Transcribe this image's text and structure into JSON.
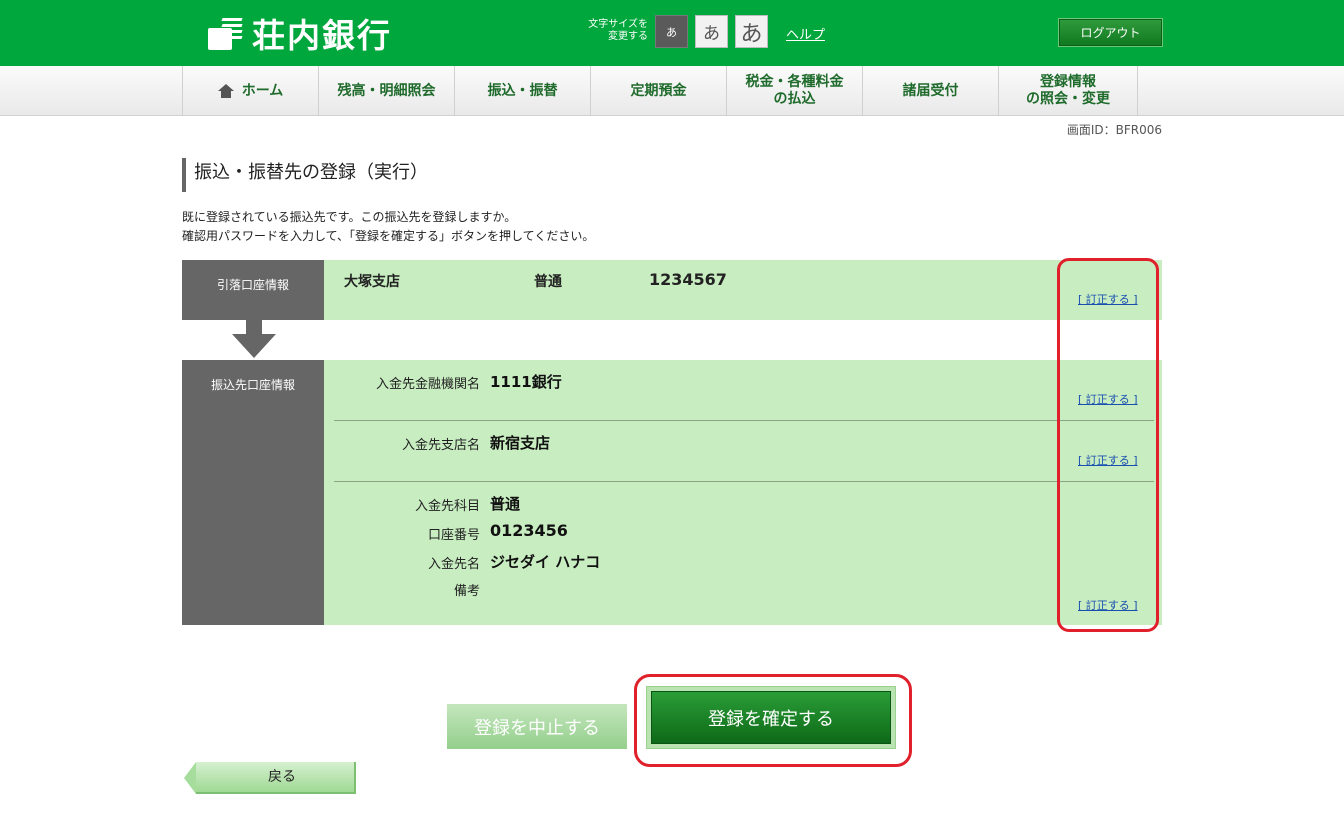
{
  "header": {
    "bank_name": "荘内銀行",
    "font_size_label_1": "文字サイズを",
    "font_size_label_2": "変更する",
    "font_size_small": "あ",
    "font_size_medium": "あ",
    "font_size_large": "あ",
    "help": "ヘルプ",
    "logout": "ログアウト"
  },
  "nav": {
    "items": [
      {
        "label": "ホーム",
        "icon": "home-icon"
      },
      {
        "label": "残高・明細照会"
      },
      {
        "label": "振込・振替"
      },
      {
        "label": "定期預金"
      },
      {
        "label_line1": "税金・各種料金",
        "label_line2": "の払込"
      },
      {
        "label": "諸届受付"
      },
      {
        "label_line1": "登録情報",
        "label_line2": "の照会・変更"
      }
    ]
  },
  "screen_id": "画面ID：BFR006",
  "page_title": "振込・振替先の登録（実行）",
  "description": {
    "line1": "既に登録されている振込先です。この振込先を登録しますか。",
    "line2": "確認用パスワードを入力して、「登録を確定する」ボタンを押してください。"
  },
  "debit_account": {
    "label": "引落口座情報",
    "branch": "大塚支店",
    "type": "普通",
    "number": "1234567",
    "correct_link": "[ 訂正する ]"
  },
  "payee_account": {
    "label": "振込先口座情報",
    "bank_label": "入金先金融機関名",
    "bank_value": "1111銀行",
    "branch_label": "入金先支店名",
    "branch_value": "新宿支店",
    "subject_label": "入金先科目",
    "subject_value": "普通",
    "number_label": "口座番号",
    "number_value": "0123456",
    "name_label": "入金先名",
    "name_value": "ジセダイ ハナコ",
    "remarks_label": "備考",
    "remarks_value": "",
    "correct_link_bank": "[ 訂正する ]",
    "correct_link_branch": "[ 訂正する ]",
    "correct_link_account": "[ 訂正する ]"
  },
  "actions": {
    "cancel": "登録を中止する",
    "confirm": "登録を確定する",
    "back": "戻る"
  },
  "colors": {
    "brand_green": "#00a73c",
    "panel_green": "#c8edc1",
    "label_gray": "#666666",
    "highlight_red": "#e0202a"
  }
}
